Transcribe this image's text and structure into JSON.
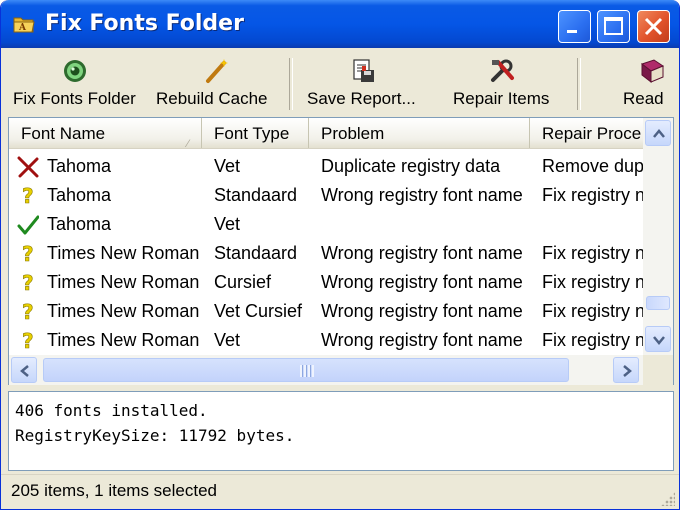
{
  "window": {
    "title": "Fix Fonts Folder",
    "controls": [
      "minimize",
      "maximize",
      "close"
    ]
  },
  "toolbar": [
    {
      "label": "Fix Fonts Folder",
      "icon": "fix-fonts-icon"
    },
    {
      "label": "Rebuild Cache",
      "icon": "wand-icon"
    },
    {
      "label": "Save Report...",
      "icon": "save-report-icon"
    },
    {
      "label": "Repair Items",
      "icon": "repair-tools-icon"
    },
    {
      "label": "Read",
      "icon": "book-icon"
    }
  ],
  "list": {
    "columns": [
      "Font Name",
      "Font Type",
      "Problem",
      "Repair Proce"
    ],
    "rows": [
      {
        "status": "error",
        "name": "Tahoma",
        "type": "Vet",
        "problem": "Duplicate registry data",
        "repair": "Remove dup"
      },
      {
        "status": "warning",
        "name": "Tahoma",
        "type": "Standaard",
        "problem": "Wrong registry font name",
        "repair": "Fix registry n"
      },
      {
        "status": "ok",
        "name": "Tahoma",
        "type": "Vet",
        "problem": "",
        "repair": ""
      },
      {
        "status": "warning",
        "name": "Times New Roman",
        "type": "Standaard",
        "problem": "Wrong registry font name",
        "repair": "Fix registry n"
      },
      {
        "status": "warning",
        "name": "Times New Roman",
        "type": "Cursief",
        "problem": "Wrong registry font name",
        "repair": "Fix registry n"
      },
      {
        "status": "warning",
        "name": "Times New Roman",
        "type": "Vet Cursief",
        "problem": "Wrong registry font name",
        "repair": "Fix registry n"
      },
      {
        "status": "warning",
        "name": "Times New Roman",
        "type": "Vet",
        "problem": "Wrong registry font name",
        "repair": "Fix registry n"
      }
    ]
  },
  "log": {
    "lines": [
      "406 fonts installed.",
      "RegistryKeySize: 11792 bytes."
    ]
  },
  "statusbar": {
    "text": "205 items,  1 items selected"
  },
  "colors": {
    "title_bar": "#0556e6",
    "error": "#a01010",
    "warning": "#e8d000",
    "ok": "#1f8a1f"
  }
}
